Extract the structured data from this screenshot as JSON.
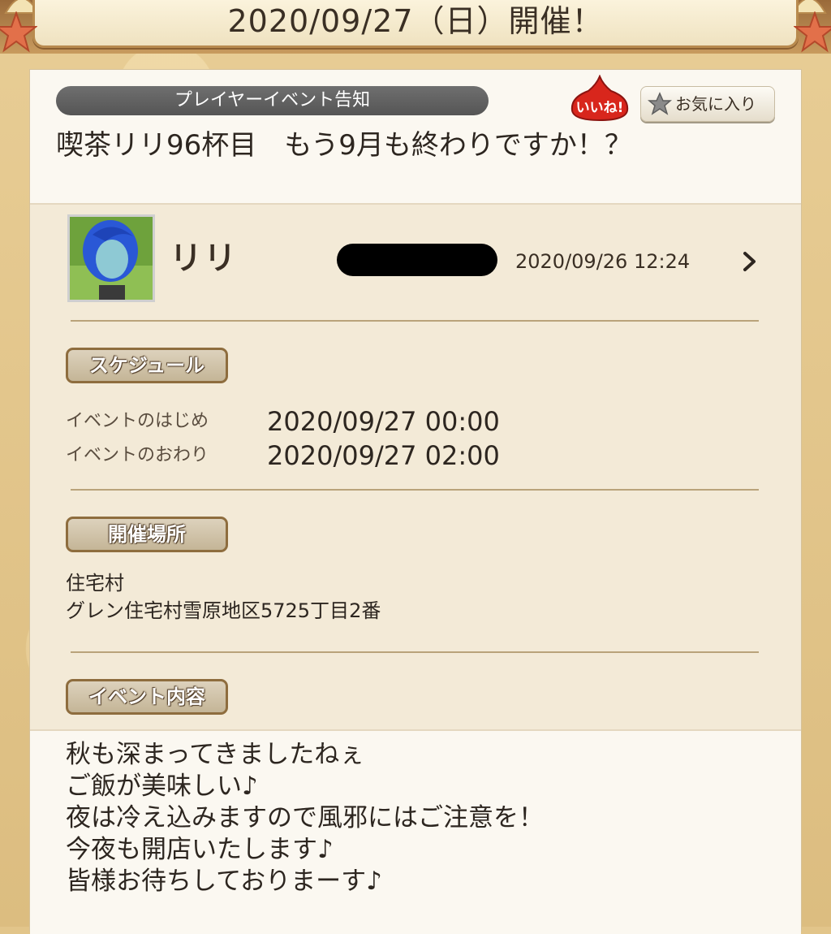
{
  "header": {
    "title": "2020/09/27（日）開催！"
  },
  "event": {
    "category": "プレイヤーイベント告知",
    "title": "喫茶リリ96杯目　もう9月も終わりですか！？",
    "like_label": "いいね!",
    "favorite_label": "お気に入り"
  },
  "author": {
    "name": "リリ",
    "posted_at": "2020/09/26  12:24"
  },
  "schedule": {
    "section_label": "スケジュール",
    "start_label": "イベントのはじめ",
    "start_value": "2020/09/27  00:00",
    "end_label": "イベントのおわり",
    "end_value": "2020/09/27  02:00"
  },
  "place": {
    "section_label": "開催場所",
    "line1": "住宅村",
    "line2": "グレン住宅村雪原地区5725丁目2番"
  },
  "content": {
    "section_label": "イベント内容",
    "lines": [
      "秋も深まってきましたねぇ",
      "ご飯が美味しい♪",
      "夜は冷え込みますので風邪にはご注意を！",
      "今夜も開店いたします♪",
      "皆様お待ちしておりまーす♪"
    ]
  },
  "colors": {
    "like_badge": "#d8261c",
    "category_pill": "#626262",
    "section_border": "#8e6d3e"
  },
  "icons": [
    "starfish-icon",
    "shell-icon",
    "slime-like-icon",
    "star-icon",
    "chevron-right-icon"
  ]
}
